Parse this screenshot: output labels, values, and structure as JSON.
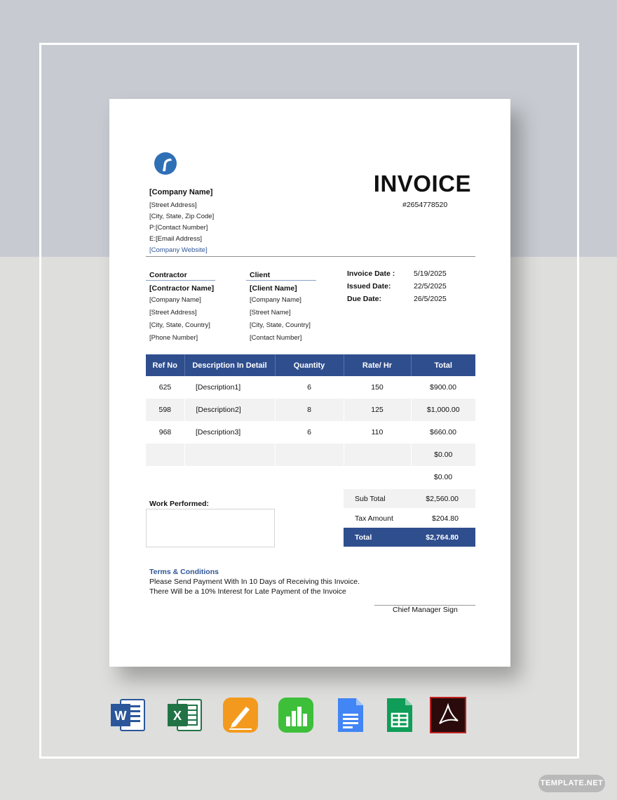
{
  "company": {
    "name": "[Company Name]",
    "street": "[Street Address]",
    "city": "[City, State, Zip Code]",
    "phone": "P:[Contact Number]",
    "email": "E:[Email Address]",
    "website": "[Company Website]"
  },
  "invoice": {
    "title": "INVOICE",
    "number": "#2654778520"
  },
  "contractor": {
    "heading": "Contractor",
    "name": "[Contractor Name]",
    "company": "[Company Name]",
    "street": "[Street Address]",
    "city": "[City, State, Country]",
    "phone": "[Phone Number]"
  },
  "client": {
    "heading": "Client",
    "name": "[Client Name]",
    "company": "[Company Name]",
    "street": "[Street Name]",
    "city": "[City, State, Country]",
    "contact": "[Contact Number]"
  },
  "dates": [
    {
      "label": "Invoice Date :",
      "value": "5/19/2025"
    },
    {
      "label": "Issued Date:",
      "value": "22/5/2025"
    },
    {
      "label": "Due Date:",
      "value": "26/5/2025"
    }
  ],
  "table": {
    "headers": [
      "Ref No",
      "Description In Detail",
      "Quantity",
      "Rate/ Hr",
      "Total"
    ],
    "rows": [
      [
        "625",
        "[Description1]",
        "6",
        "150",
        "$900.00"
      ],
      [
        "598",
        "[Description2]",
        "8",
        "125",
        "$1,000.00"
      ],
      [
        "968",
        "[Description3]",
        "6",
        "110",
        "$660.00"
      ],
      [
        "",
        "",
        "",
        "",
        "$0.00"
      ],
      [
        "",
        "",
        "",
        "",
        "$0.00"
      ]
    ]
  },
  "summary": {
    "subtotal_label": "Sub Total",
    "subtotal_value": "$2,560.00",
    "tax_label": "Tax Amount",
    "tax_value": "$204.80",
    "total_label": "Total",
    "total_value": "$2,764.80"
  },
  "work_performed_label": "Work Performed:",
  "terms": {
    "title": "Terms & Conditions",
    "line1": "Please Send Payment With In 10 Days of Receiving this Invoice.",
    "line2": "There Will be a 10% Interest  for Late Payment  of the Invoice"
  },
  "signature_label": "Chief Manager Sign",
  "formats": [
    {
      "icon": "word-icon",
      "letter": "W",
      "color": "#2b579a"
    },
    {
      "icon": "excel-icon",
      "letter": "X",
      "color": "#217346"
    },
    {
      "icon": "pages-icon",
      "color": "#f39a1e"
    },
    {
      "icon": "numbers-icon",
      "color": "#3dbf3a"
    },
    {
      "icon": "google-docs-icon",
      "color": "#4285f4"
    },
    {
      "icon": "google-sheets-icon",
      "color": "#0f9d58"
    },
    {
      "icon": "pdf-icon",
      "color": "#8b1a1a"
    }
  ],
  "badge": "TEMPLATE.NET"
}
